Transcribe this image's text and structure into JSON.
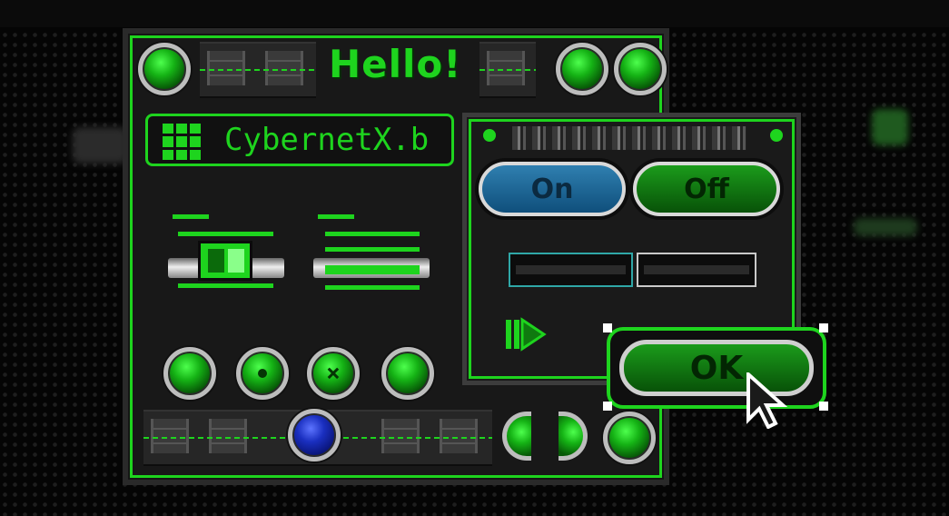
{
  "window": {
    "title": "Hello!",
    "name_label": "CybernetX.b"
  },
  "dialog": {
    "on_label": "On",
    "off_label": "Off",
    "ok_label": "OK"
  },
  "icons": [
    "grid-icon",
    "play-icon",
    "cursor-icon"
  ],
  "colors": {
    "accent": "#1ed41e",
    "on_button": "#1f6a9c",
    "off_button": "#0f7a0f",
    "background": "#050505"
  }
}
